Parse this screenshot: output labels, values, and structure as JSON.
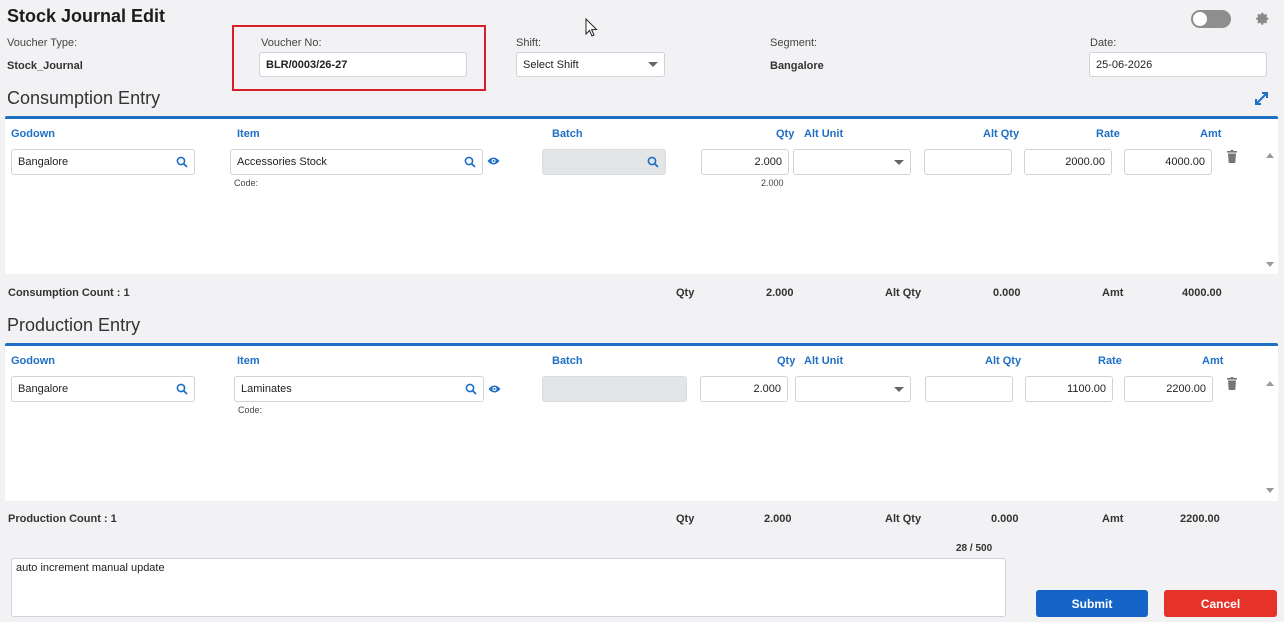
{
  "page": {
    "title": "Stock Journal Edit"
  },
  "header": {
    "voucher_type_label": "Voucher Type:",
    "voucher_type_value": "Stock_Journal",
    "voucher_no_label": "Voucher No:",
    "voucher_no_value": "BLR/0003/26-27",
    "shift_label": "Shift:",
    "shift_value": "Select Shift",
    "segment_label": "Segment:",
    "segment_value": "Bangalore",
    "date_label": "Date:",
    "date_value": "25-06-2026"
  },
  "columns": {
    "godown": "Godown",
    "item": "Item",
    "batch": "Batch",
    "qty": "Qty",
    "alt_unit": "Alt Unit",
    "alt_qty": "Alt Qty",
    "rate": "Rate",
    "amt": "Amt"
  },
  "consumption": {
    "title": "Consumption Entry",
    "row": {
      "godown": "Bangalore",
      "item": "Accessories Stock",
      "code_label": "Code:",
      "qty": "2.000",
      "qty_sub": "2.000",
      "alt_qty": "",
      "rate": "2000.00",
      "amt": "4000.00"
    },
    "summary": {
      "count_label": "Consumption Count : 1",
      "qty_label": "Qty",
      "qty": "2.000",
      "alt_qty_label": "Alt Qty",
      "alt_qty": "0.000",
      "amt_label": "Amt",
      "amt": "4000.00"
    }
  },
  "production": {
    "title": "Production Entry",
    "row": {
      "godown": "Bangalore",
      "item": "Laminates",
      "code_label": "Code:",
      "qty": "2.000",
      "alt_qty": "",
      "rate": "1100.00",
      "amt": "2200.00"
    },
    "summary": {
      "count_label": "Production Count : 1",
      "qty_label": "Qty",
      "qty": "2.000",
      "alt_qty_label": "Alt Qty",
      "alt_qty": "0.000",
      "amt_label": "Amt",
      "amt": "2200.00"
    }
  },
  "narration": {
    "value": "auto increment manual update",
    "counter": "28 / 500"
  },
  "actions": {
    "submit": "Submit",
    "cancel": "Cancel"
  },
  "colors": {
    "accent": "#1f6fc5",
    "submit": "#1565c8",
    "cancel": "#e5332a",
    "highlight": "#d9202a"
  }
}
